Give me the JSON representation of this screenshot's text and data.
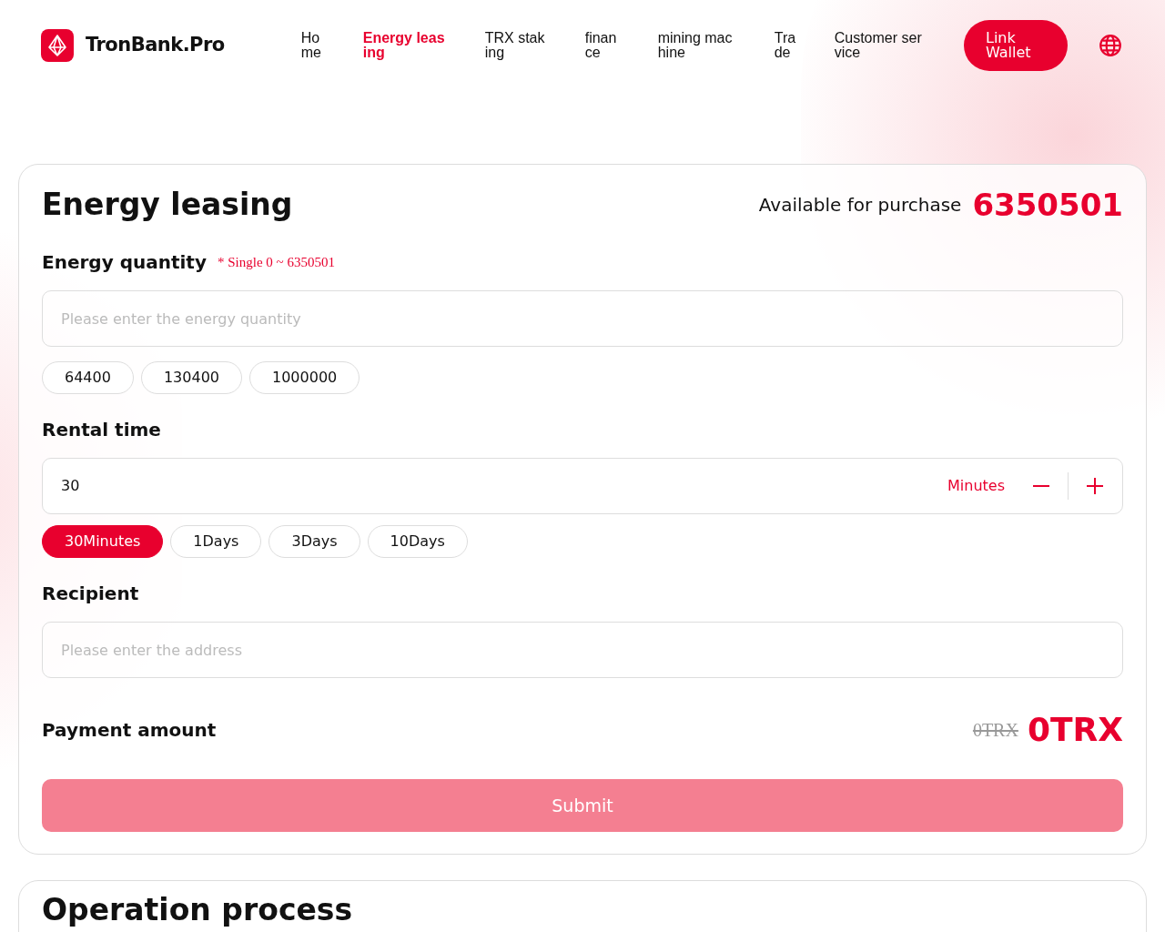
{
  "header": {
    "brand": "TronBank.Pro",
    "nav": [
      {
        "label": "Home",
        "selected": false
      },
      {
        "label": "Energy leasing",
        "selected": true
      },
      {
        "label": "TRX staking",
        "selected": false
      },
      {
        "label": "finance",
        "selected": false
      },
      {
        "label": "mining machine",
        "selected": false
      },
      {
        "label": "Trade",
        "selected": false
      },
      {
        "label": "Customer service",
        "selected": false
      }
    ],
    "wallet_button": "Link Wallet"
  },
  "leasing": {
    "title": "Energy leasing",
    "available_label": "Available for purchase",
    "available_value": "6350501",
    "quantity": {
      "label": "Energy quantity",
      "hint": "* Single 0 ~ 6350501",
      "placeholder": "Please enter the energy quantity",
      "presets": [
        {
          "label": "64400"
        },
        {
          "label": "130400"
        },
        {
          "label": "1000000"
        }
      ]
    },
    "rental": {
      "label": "Rental time",
      "value": "30",
      "unit": "Minutes",
      "presets": [
        {
          "label": "30Minutes",
          "selected": true
        },
        {
          "label": "1Days",
          "selected": false
        },
        {
          "label": "3Days",
          "selected": false
        },
        {
          "label": "10Days",
          "selected": false
        }
      ]
    },
    "recipient": {
      "label": "Recipient",
      "placeholder": "Please enter the address"
    },
    "payment": {
      "label": "Payment amount",
      "original": "0TRX",
      "amount": "0TRX"
    },
    "submit": {
      "label": "Submit",
      "disabled": true
    }
  },
  "process": {
    "title": "Operation process"
  }
}
